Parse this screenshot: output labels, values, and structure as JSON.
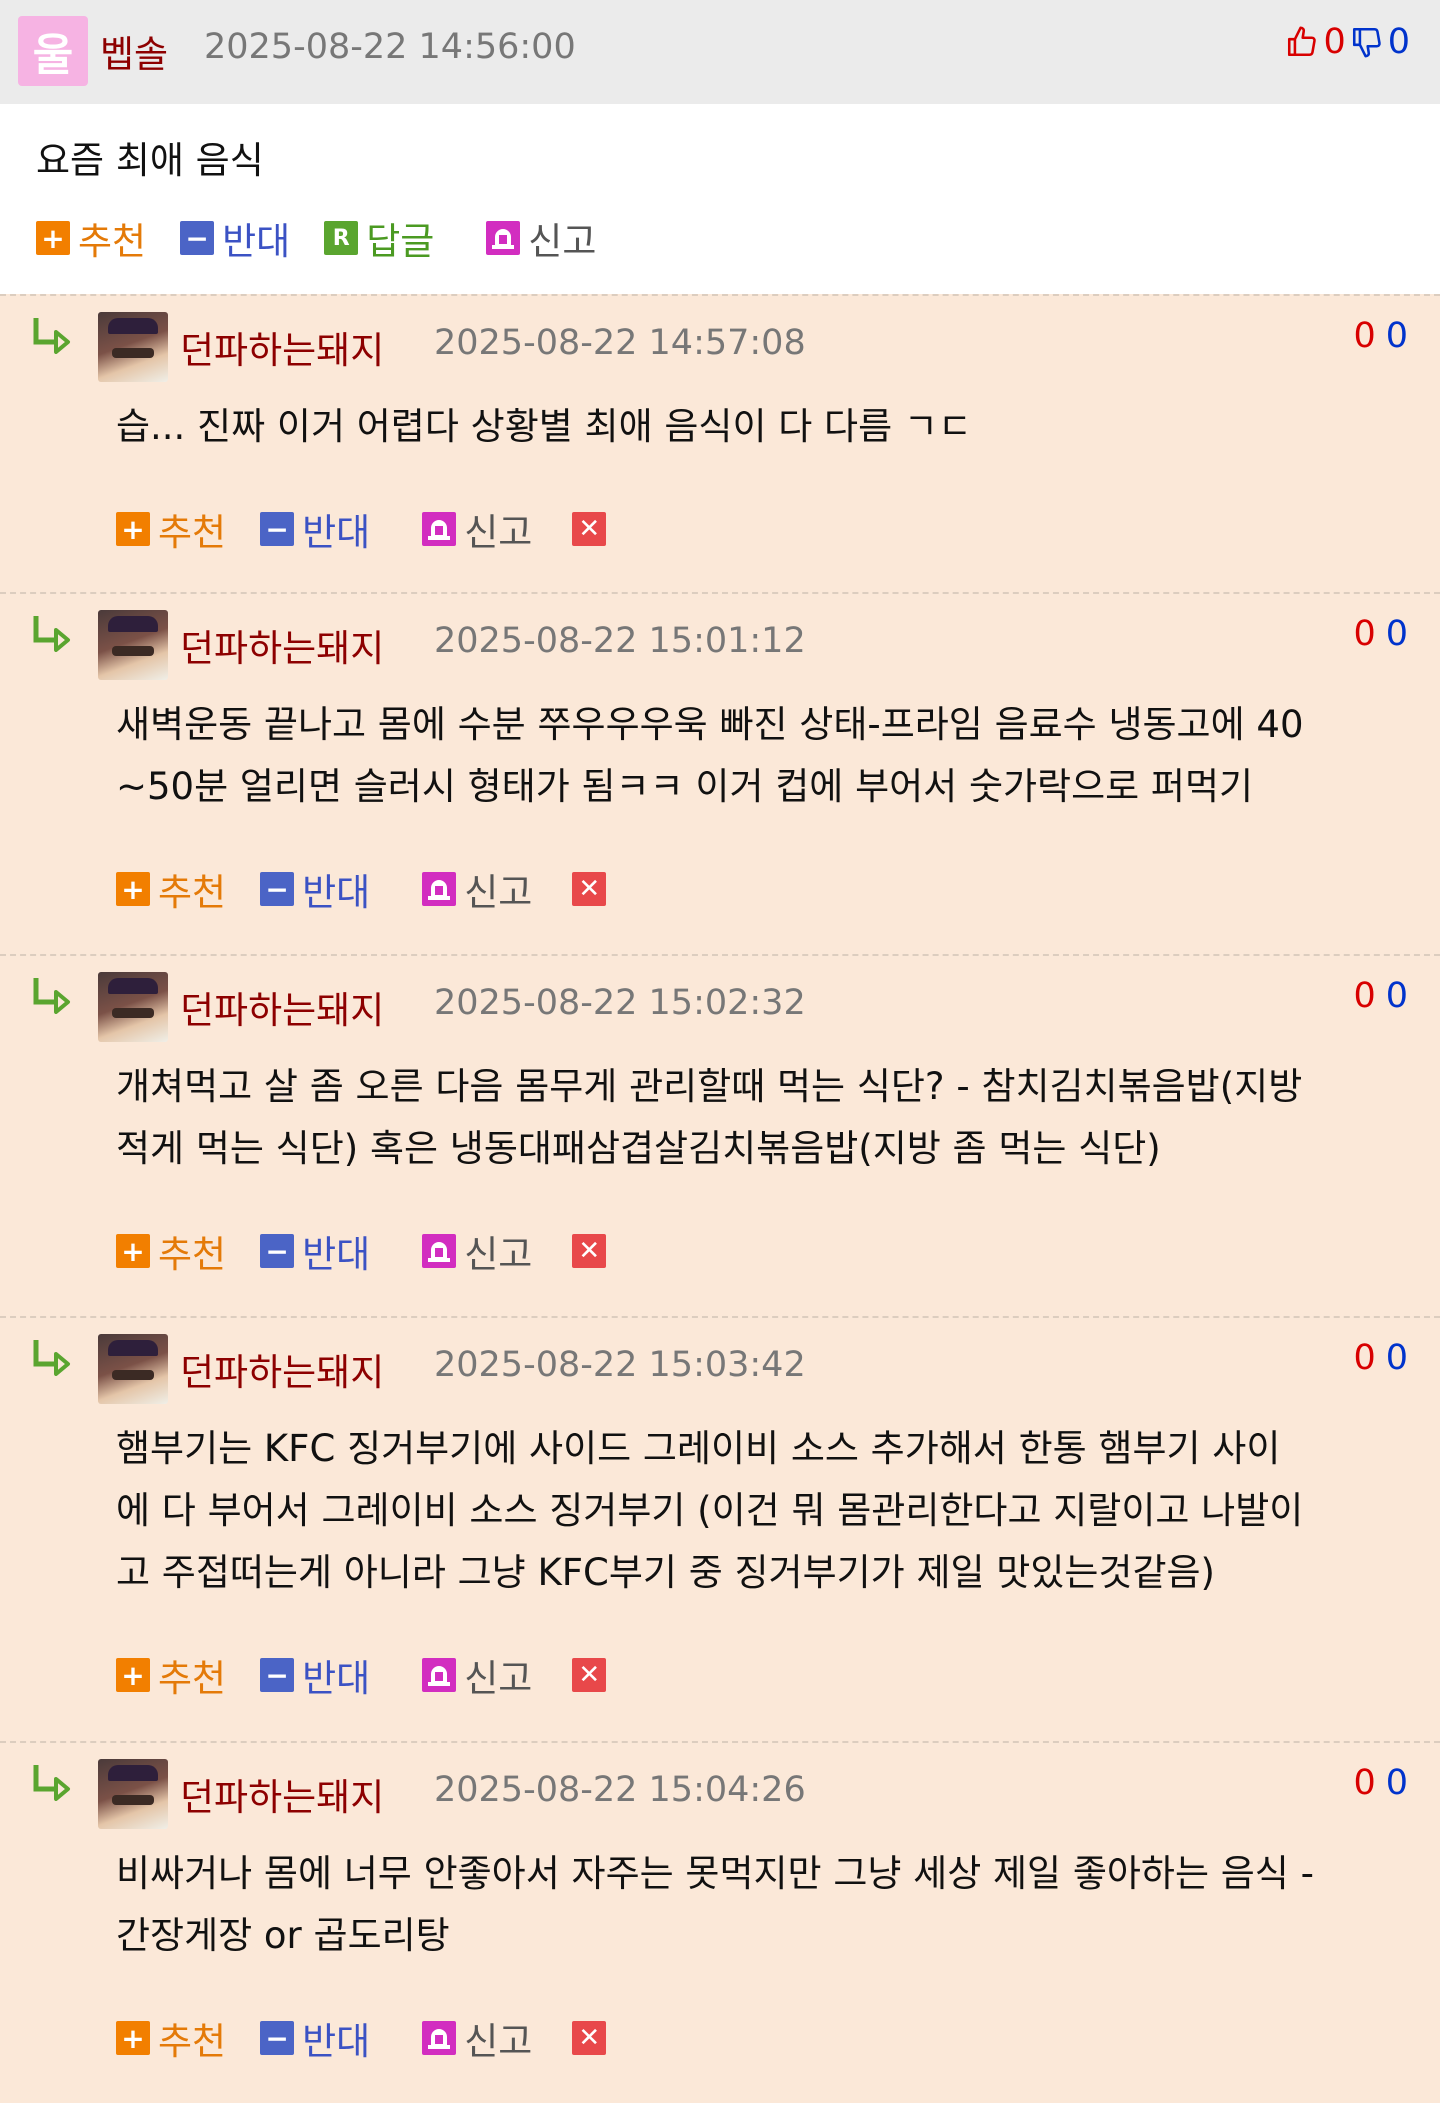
{
  "post": {
    "avatar_char": "울",
    "author": "벱솔",
    "date": "2025-08-22 14:56:00",
    "likes": "0",
    "dislikes": "0",
    "content": "요즘 최애 음식",
    "actions": {
      "recommend": "추천",
      "oppose": "반대",
      "reply": "답글",
      "report": "신고"
    }
  },
  "comment_actions": {
    "recommend": "추천",
    "oppose": "반대",
    "report": "신고"
  },
  "comments": [
    {
      "author": "던파하는돼지",
      "date": "2025-08-22 14:57:08",
      "up": "0",
      "down": "0",
      "lines": [
        "습... 진짜 이거 어렵다 상황별 최애 음식이 다 다름 ㄱㄷ"
      ]
    },
    {
      "author": "던파하는돼지",
      "date": "2025-08-22 15:01:12",
      "up": "0",
      "down": "0",
      "lines": [
        "새벽운동 끝나고 몸에 수분 쭈우우우욱 빠진 상태-프라임 음료수 냉동고에 40",
        "~50분 얼리면 슬러시 형태가 됨ㅋㅋ 이거 컵에 부어서 숫가락으로 퍼먹기"
      ]
    },
    {
      "author": "던파하는돼지",
      "date": "2025-08-22 15:02:32",
      "up": "0",
      "down": "0",
      "lines": [
        "개쳐먹고 살 좀 오른 다음 몸무게 관리할때 먹는 식단? - 참치김치볶음밥(지방",
        "적게 먹는 식단) 혹은 냉동대패삼겹살김치볶음밥(지방 좀 먹는 식단)"
      ]
    },
    {
      "author": "던파하는돼지",
      "date": "2025-08-22 15:03:42",
      "up": "0",
      "down": "0",
      "lines": [
        "햄부기는 KFC 징거부기에 사이드 그레이비 소스 추가해서 한통 햄부기 사이",
        "에 다 부어서 그레이비 소스 징거부기 (이건 뭐 몸관리한다고 지랄이고 나발이",
        "고 주접떠는게 아니라 그냥 KFC부기 중 징거부기가 제일 맛있는것같음)"
      ]
    },
    {
      "author": "던파하는돼지",
      "date": "2025-08-22 15:04:26",
      "up": "0",
      "down": "0",
      "lines": [
        "비싸거나 몸에 너무 안좋아서 자주는 못먹지만 그냥 세상 제일 좋아하는 음식 -",
        "간장게장 or 곱도리탕"
      ]
    }
  ]
}
